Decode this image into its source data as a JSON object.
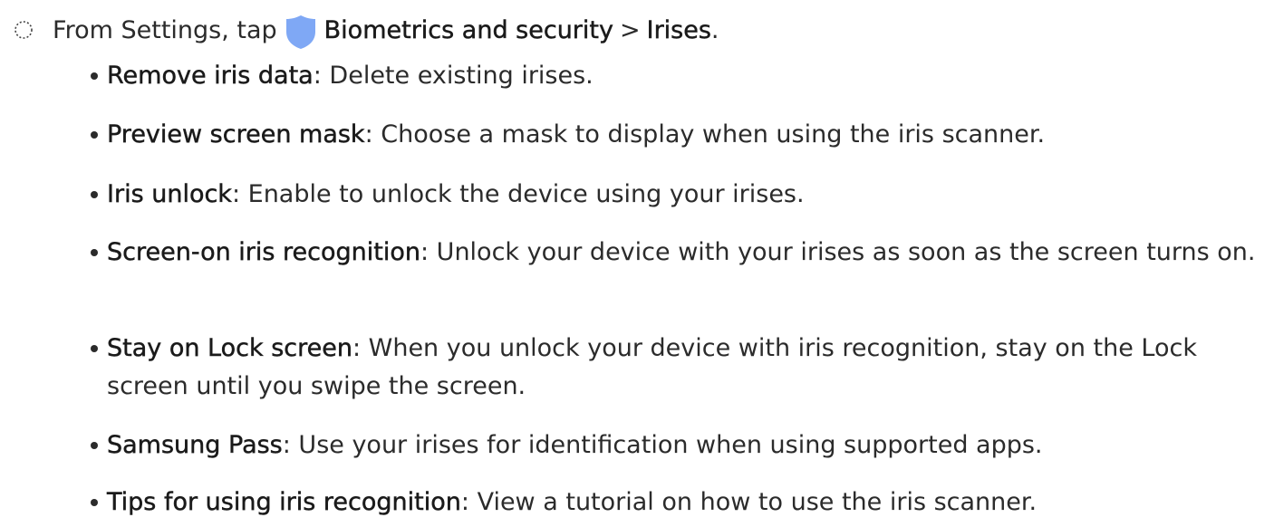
{
  "step": {
    "prefix": "From Settings, tap",
    "link1": "Biometrics and security",
    "separator": ">",
    "link2": "Irises",
    "suffix": ".",
    "icon_color": "#7fa8f5"
  },
  "items": [
    {
      "term": "Remove iris data",
      "desc": ": Delete existing irises."
    },
    {
      "term": "Preview screen mask",
      "desc": ": Choose a mask to display when using the iris scanner."
    },
    {
      "term": "Iris unlock",
      "desc": ": Enable to unlock the device using your irises."
    },
    {
      "term": "Screen-on iris recognition",
      "desc": ": Unlock your device with your irises as soon as the screen turns on."
    },
    {
      "term": "Stay on Lock screen",
      "desc": ": When you unlock your device with iris recognition, stay on the Lock screen until you swipe the screen."
    },
    {
      "term": "Samsung Pass",
      "desc": ": Use your irises for identification when using supported apps."
    },
    {
      "term": "Tips for using iris recognition",
      "desc": ": View a tutorial on how to use the iris scanner."
    }
  ]
}
